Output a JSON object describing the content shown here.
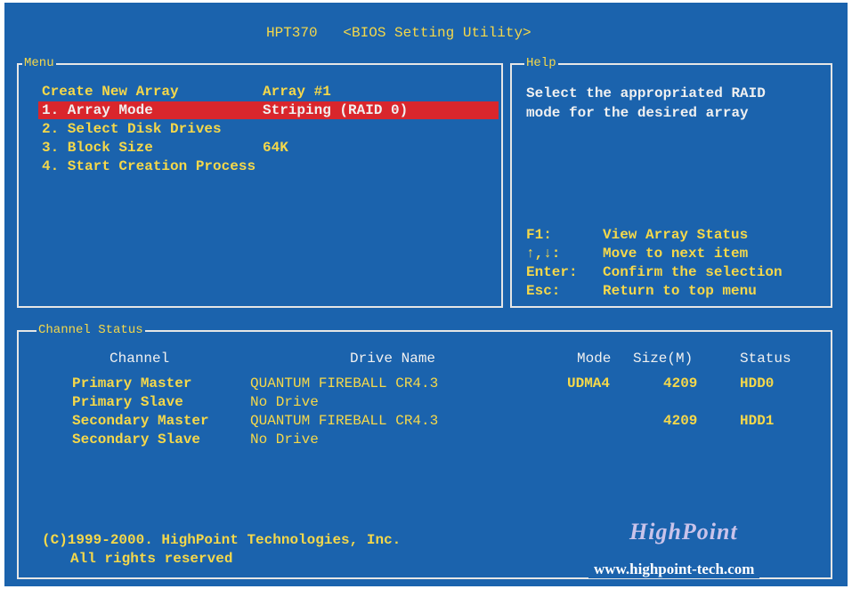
{
  "title": {
    "program": "HPT370",
    "utility": "<BIOS Setting Utility>"
  },
  "menu": {
    "legend": "Menu",
    "create_label": "Create New Array",
    "create_value": "Array #1",
    "items": [
      {
        "label": "1. Array Mode",
        "value": "Striping (RAID 0)",
        "selected": true
      },
      {
        "label": "2. Select Disk Drives",
        "value": ""
      },
      {
        "label": "3. Block Size",
        "value": "64K"
      },
      {
        "label": "4. Start Creation Process",
        "value": ""
      }
    ]
  },
  "help": {
    "legend": "Help",
    "lines": [
      "Select the appropriated RAID",
      "mode for the desired array"
    ],
    "keys": [
      {
        "key": "F1:",
        "desc": "View Array Status"
      },
      {
        "key": "↑,↓:",
        "desc": "Move to next item"
      },
      {
        "key": "Enter:",
        "desc": "Confirm the selection"
      },
      {
        "key": "Esc:",
        "desc": "Return to top menu"
      }
    ]
  },
  "channel_status": {
    "legend": "Channel Status",
    "headers": {
      "channel": "Channel",
      "drive_name": "Drive Name",
      "mode": "Mode",
      "size": "Size(M)",
      "status": "Status"
    },
    "rows": [
      {
        "channel": "Primary Master",
        "drive_name": "QUANTUM FIREBALL CR4.3",
        "mode": "UDMA4",
        "size": "4209",
        "status": "HDD0"
      },
      {
        "channel": "Primary Slave",
        "drive_name": "No Drive",
        "mode": "",
        "size": "",
        "status": ""
      },
      {
        "channel": "Secondary Master",
        "drive_name": "QUANTUM FIREBALL CR4.3",
        "mode": "",
        "size": "4209",
        "status": "HDD1"
      },
      {
        "channel": "Secondary Slave",
        "drive_name": "No Drive",
        "mode": "",
        "size": "",
        "status": ""
      }
    ]
  },
  "footer": {
    "copyright_line1": "(C)1999-2000. HighPoint Technologies, Inc.",
    "copyright_line2": "All rights reserved",
    "logo": "HighPoint",
    "url": "www.highpoint-tech.com"
  },
  "colors": {
    "background": "#1b63ad",
    "text_yellow": "#f5d84a",
    "text_white": "#f0f0f0",
    "selection": "#d9262c",
    "border": "#e6e6e6"
  }
}
